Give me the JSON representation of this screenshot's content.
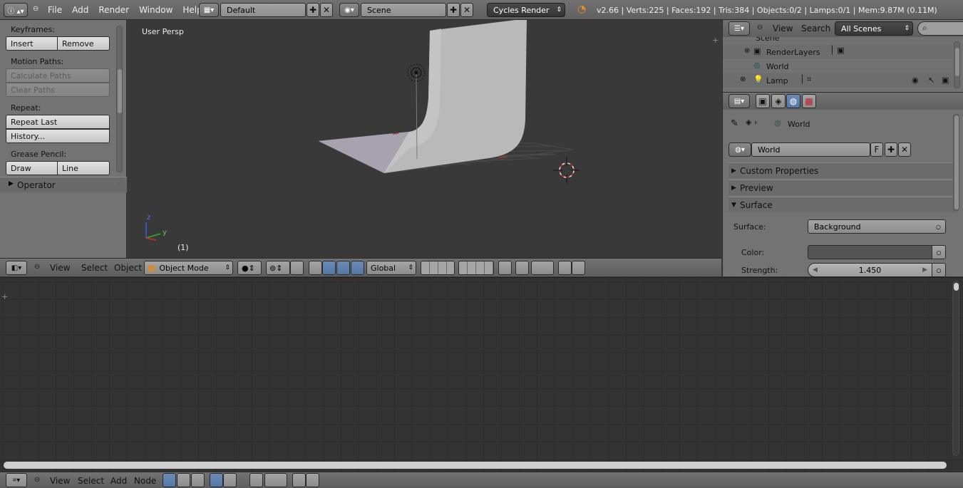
{
  "topbar": {
    "menus": [
      "File",
      "Add",
      "Render",
      "Window",
      "Help"
    ],
    "layout_name": "Default",
    "scene_name": "Scene",
    "engine": "Cycles Render",
    "stats": "v2.66 | Verts:225 | Faces:192 | Tris:384 | Objects:0/2 | Lamps:0/1 | Mem:9.87M (0.11M)"
  },
  "toolshelf": {
    "keyframes_label": "Keyframes:",
    "insert": "Insert",
    "remove": "Remove",
    "motion_paths_label": "Motion Paths:",
    "calculate_paths": "Calculate Paths",
    "clear_paths": "Clear Paths",
    "repeat_label": "Repeat:",
    "repeat_last": "Repeat Last",
    "history": "History...",
    "grease_pencil_label": "Grease Pencil:",
    "draw": "Draw",
    "line": "Line",
    "operator": "Operator"
  },
  "viewport": {
    "view_name": "User Persp",
    "frame": "(1)",
    "axis_z": "z",
    "axis_y": "y"
  },
  "viewport_header": {
    "menus": [
      "View",
      "Select",
      "Object"
    ],
    "mode": "Object Mode",
    "orientation": "Global"
  },
  "outliner": {
    "menus": [
      "View",
      "Search"
    ],
    "display_mode": "All Scenes",
    "items": [
      "Scene",
      "RenderLayers",
      "World",
      "Lamp"
    ]
  },
  "properties": {
    "breadcrumb": "World",
    "world_name": "World",
    "fake_user": "F",
    "panels": [
      "Custom Properties",
      "Preview",
      "Surface"
    ],
    "surface_label": "Surface:",
    "surface_value": "Background",
    "color_label": "Color:",
    "color_value": "#545454",
    "strength_label": "Strength:",
    "strength_value": "1.450"
  },
  "node_header": {
    "menus": [
      "View",
      "Select",
      "Add",
      "Node"
    ]
  }
}
